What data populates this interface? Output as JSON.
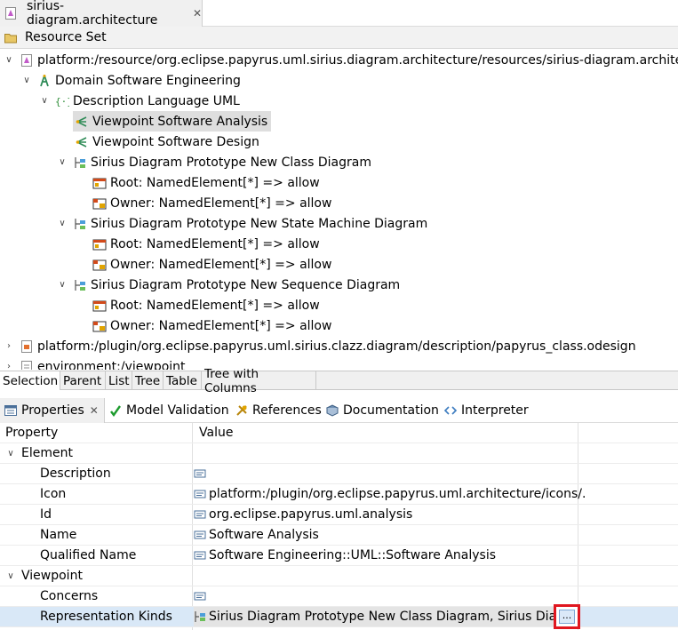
{
  "editor": {
    "tab_title": "sirius-diagram.architecture",
    "close_glyph": "✕",
    "resource_set_label": "Resource Set"
  },
  "tree": {
    "rows": [
      {
        "label": "platform:/resource/org.eclipse.papyrus.uml.sirius.diagram.architecture/resources/sirius-diagram.architecture",
        "expanded": true,
        "icon": "architecture-file-icon"
      },
      {
        "label": "Domain Software Engineering",
        "expanded": true,
        "icon": "domain-icon"
      },
      {
        "label": "Description Language UML",
        "expanded": true,
        "icon": "language-icon"
      },
      {
        "label": "Viewpoint Software Analysis",
        "icon": "viewpoint-icon",
        "selected": true
      },
      {
        "label": "Viewpoint Software Design",
        "icon": "viewpoint-icon"
      },
      {
        "label": "Sirius Diagram Prototype New Class Diagram",
        "expanded": true,
        "icon": "diagram-prototype-icon"
      },
      {
        "label": "Root: NamedElement[*] => allow",
        "icon": "rule-icon"
      },
      {
        "label": "Owner: NamedElement[*] => allow",
        "icon": "rule-icon"
      },
      {
        "label": "Sirius Diagram Prototype New State Machine Diagram",
        "expanded": true,
        "icon": "diagram-prototype-icon"
      },
      {
        "label": "Root: NamedElement[*] => allow",
        "icon": "rule-icon"
      },
      {
        "label": "Owner: NamedElement[*] => allow",
        "icon": "rule-icon"
      },
      {
        "label": "Sirius Diagram Prototype New Sequence Diagram",
        "expanded": true,
        "icon": "diagram-prototype-icon"
      },
      {
        "label": "Root: NamedElement[*] => allow",
        "icon": "rule-icon"
      },
      {
        "label": "Owner: NamedElement[*] => allow",
        "icon": "rule-icon"
      },
      {
        "label": "platform:/plugin/org.eclipse.papyrus.uml.sirius.clazz.diagram/description/papyrus_class.odesign",
        "expanded": false,
        "icon": "odesign-file-icon"
      },
      {
        "label": "environment:/viewpoint",
        "expanded": false,
        "icon": "file-icon"
      }
    ]
  },
  "view_tabs": [
    "Selection",
    "Parent",
    "List",
    "Tree",
    "Table",
    "Tree with Columns"
  ],
  "properties_view": {
    "tabs": [
      {
        "label": "Properties",
        "icon": "properties-icon"
      },
      {
        "label": "Model Validation",
        "icon": "checkmark-icon"
      },
      {
        "label": "References",
        "icon": "references-icon"
      },
      {
        "label": "Documentation",
        "icon": "book-icon"
      },
      {
        "label": "Interpreter",
        "icon": "code-brackets-icon"
      }
    ],
    "columns": {
      "property": "Property",
      "value": "Value"
    },
    "groups": {
      "element": "Element",
      "viewpoint": "Viewpoint"
    },
    "rows": {
      "description": {
        "name": "Description",
        "value": ""
      },
      "icon": {
        "name": "Icon",
        "value": "platform:/plugin/org.eclipse.papyrus.uml.architecture/icons/..."
      },
      "id": {
        "name": "Id",
        "value": "org.eclipse.papyrus.uml.analysis"
      },
      "name": {
        "name": "Name",
        "value": "Software Analysis"
      },
      "qualified_name": {
        "name": "Qualified Name",
        "value": "Software Engineering::UML::Software Analysis"
      },
      "concerns": {
        "name": "Concerns",
        "value": ""
      },
      "representation_kinds": {
        "name": "Representation Kinds",
        "value": "Sirius Diagram Prototype New Class Diagram, Sirius Diagram Prototype New State Machine Diagram, Sirius Diagram Prototype New Sequence Diagram"
      }
    },
    "dots_button_label": "..."
  },
  "colors": {
    "highlight_border": "#e0161f",
    "selected_row": "#d9e8f7"
  }
}
